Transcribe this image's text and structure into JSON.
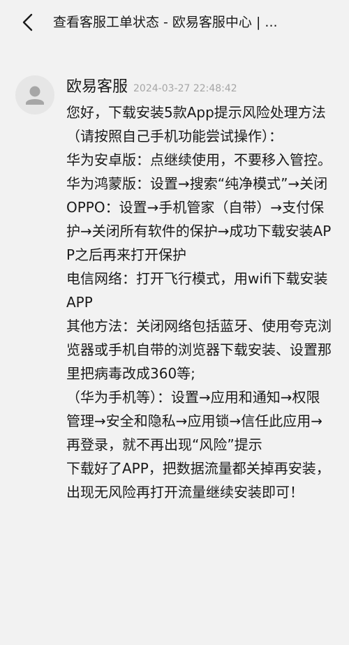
{
  "header": {
    "title": "查看客服工单状态 - 欧易客服中心 | ..."
  },
  "message": {
    "sender": "欧易客服",
    "timestamp": "2024-03-27 22:48:42",
    "paragraphs": [
      "您好，下载安装5款App提示风险处理方法（请按照自己手机功能尝试操作）：",
      "华为安卓版：点继续使用，不要移入管控。",
      "华为鸿蒙版：设置→搜索“纯净模式”→关闭",
      "OPPO：设置→手机管家（自带）→支付保护→关闭所有软件的保护→成功下载安装APP之后再来打开保护",
      "电信网络：打开飞行模式，用wifi下载安装APP",
      "其他方法：关闭网络包括蓝牙、使用夸克浏览器或手机自带的浏览器下载安装、设置那里把病毒改成360等;",
      "（华为手机等）：设置→应用和通知→权限管理→安全和隐私→应用锁→信任此应用→再登录，就不再出现“风险”提示",
      "下载好了APP，把数据流量都关掉再安装，出现无风险再打开流量继续安装即可！"
    ]
  }
}
